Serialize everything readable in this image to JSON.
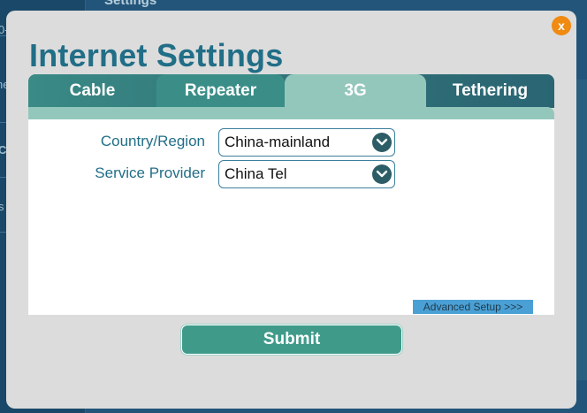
{
  "background": {
    "title_fragment": "Settings",
    "sidebar_fragments": [
      "0-",
      "he",
      "C",
      "s"
    ]
  },
  "dialog": {
    "title": "Internet Settings",
    "close_label": "x"
  },
  "tabs": [
    {
      "label": "Cable",
      "active": false
    },
    {
      "label": "Repeater",
      "active": false
    },
    {
      "label": "3G",
      "active": true
    },
    {
      "label": "Tethering",
      "active": false
    }
  ],
  "form": {
    "country_label": "Country/Region",
    "country_value": "China-mainland",
    "provider_label": "Service Provider",
    "provider_value": "China Tel"
  },
  "advanced_link": "Advanced Setup >>>",
  "submit_label": "Submit",
  "colors": {
    "title": "#216e87",
    "active_tab": "#93c7bb",
    "submit": "#3f9a8a",
    "close": "#f08a10"
  },
  "icons": {
    "dropdown": "chevron-down-icon",
    "close": "close-icon"
  }
}
